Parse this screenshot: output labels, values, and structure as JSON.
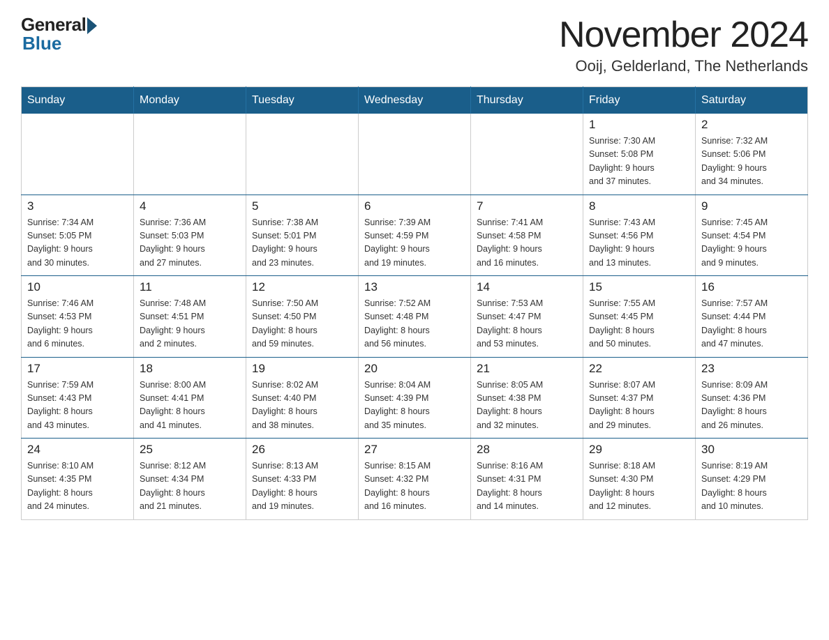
{
  "header": {
    "logo_general": "General",
    "logo_blue": "Blue",
    "title": "November 2024",
    "subtitle": "Ooij, Gelderland, The Netherlands"
  },
  "weekdays": [
    "Sunday",
    "Monday",
    "Tuesday",
    "Wednesday",
    "Thursday",
    "Friday",
    "Saturday"
  ],
  "weeks": [
    [
      {
        "day": "",
        "info": ""
      },
      {
        "day": "",
        "info": ""
      },
      {
        "day": "",
        "info": ""
      },
      {
        "day": "",
        "info": ""
      },
      {
        "day": "",
        "info": ""
      },
      {
        "day": "1",
        "info": "Sunrise: 7:30 AM\nSunset: 5:08 PM\nDaylight: 9 hours\nand 37 minutes."
      },
      {
        "day": "2",
        "info": "Sunrise: 7:32 AM\nSunset: 5:06 PM\nDaylight: 9 hours\nand 34 minutes."
      }
    ],
    [
      {
        "day": "3",
        "info": "Sunrise: 7:34 AM\nSunset: 5:05 PM\nDaylight: 9 hours\nand 30 minutes."
      },
      {
        "day": "4",
        "info": "Sunrise: 7:36 AM\nSunset: 5:03 PM\nDaylight: 9 hours\nand 27 minutes."
      },
      {
        "day": "5",
        "info": "Sunrise: 7:38 AM\nSunset: 5:01 PM\nDaylight: 9 hours\nand 23 minutes."
      },
      {
        "day": "6",
        "info": "Sunrise: 7:39 AM\nSunset: 4:59 PM\nDaylight: 9 hours\nand 19 minutes."
      },
      {
        "day": "7",
        "info": "Sunrise: 7:41 AM\nSunset: 4:58 PM\nDaylight: 9 hours\nand 16 minutes."
      },
      {
        "day": "8",
        "info": "Sunrise: 7:43 AM\nSunset: 4:56 PM\nDaylight: 9 hours\nand 13 minutes."
      },
      {
        "day": "9",
        "info": "Sunrise: 7:45 AM\nSunset: 4:54 PM\nDaylight: 9 hours\nand 9 minutes."
      }
    ],
    [
      {
        "day": "10",
        "info": "Sunrise: 7:46 AM\nSunset: 4:53 PM\nDaylight: 9 hours\nand 6 minutes."
      },
      {
        "day": "11",
        "info": "Sunrise: 7:48 AM\nSunset: 4:51 PM\nDaylight: 9 hours\nand 2 minutes."
      },
      {
        "day": "12",
        "info": "Sunrise: 7:50 AM\nSunset: 4:50 PM\nDaylight: 8 hours\nand 59 minutes."
      },
      {
        "day": "13",
        "info": "Sunrise: 7:52 AM\nSunset: 4:48 PM\nDaylight: 8 hours\nand 56 minutes."
      },
      {
        "day": "14",
        "info": "Sunrise: 7:53 AM\nSunset: 4:47 PM\nDaylight: 8 hours\nand 53 minutes."
      },
      {
        "day": "15",
        "info": "Sunrise: 7:55 AM\nSunset: 4:45 PM\nDaylight: 8 hours\nand 50 minutes."
      },
      {
        "day": "16",
        "info": "Sunrise: 7:57 AM\nSunset: 4:44 PM\nDaylight: 8 hours\nand 47 minutes."
      }
    ],
    [
      {
        "day": "17",
        "info": "Sunrise: 7:59 AM\nSunset: 4:43 PM\nDaylight: 8 hours\nand 43 minutes."
      },
      {
        "day": "18",
        "info": "Sunrise: 8:00 AM\nSunset: 4:41 PM\nDaylight: 8 hours\nand 41 minutes."
      },
      {
        "day": "19",
        "info": "Sunrise: 8:02 AM\nSunset: 4:40 PM\nDaylight: 8 hours\nand 38 minutes."
      },
      {
        "day": "20",
        "info": "Sunrise: 8:04 AM\nSunset: 4:39 PM\nDaylight: 8 hours\nand 35 minutes."
      },
      {
        "day": "21",
        "info": "Sunrise: 8:05 AM\nSunset: 4:38 PM\nDaylight: 8 hours\nand 32 minutes."
      },
      {
        "day": "22",
        "info": "Sunrise: 8:07 AM\nSunset: 4:37 PM\nDaylight: 8 hours\nand 29 minutes."
      },
      {
        "day": "23",
        "info": "Sunrise: 8:09 AM\nSunset: 4:36 PM\nDaylight: 8 hours\nand 26 minutes."
      }
    ],
    [
      {
        "day": "24",
        "info": "Sunrise: 8:10 AM\nSunset: 4:35 PM\nDaylight: 8 hours\nand 24 minutes."
      },
      {
        "day": "25",
        "info": "Sunrise: 8:12 AM\nSunset: 4:34 PM\nDaylight: 8 hours\nand 21 minutes."
      },
      {
        "day": "26",
        "info": "Sunrise: 8:13 AM\nSunset: 4:33 PM\nDaylight: 8 hours\nand 19 minutes."
      },
      {
        "day": "27",
        "info": "Sunrise: 8:15 AM\nSunset: 4:32 PM\nDaylight: 8 hours\nand 16 minutes."
      },
      {
        "day": "28",
        "info": "Sunrise: 8:16 AM\nSunset: 4:31 PM\nDaylight: 8 hours\nand 14 minutes."
      },
      {
        "day": "29",
        "info": "Sunrise: 8:18 AM\nSunset: 4:30 PM\nDaylight: 8 hours\nand 12 minutes."
      },
      {
        "day": "30",
        "info": "Sunrise: 8:19 AM\nSunset: 4:29 PM\nDaylight: 8 hours\nand 10 minutes."
      }
    ]
  ]
}
